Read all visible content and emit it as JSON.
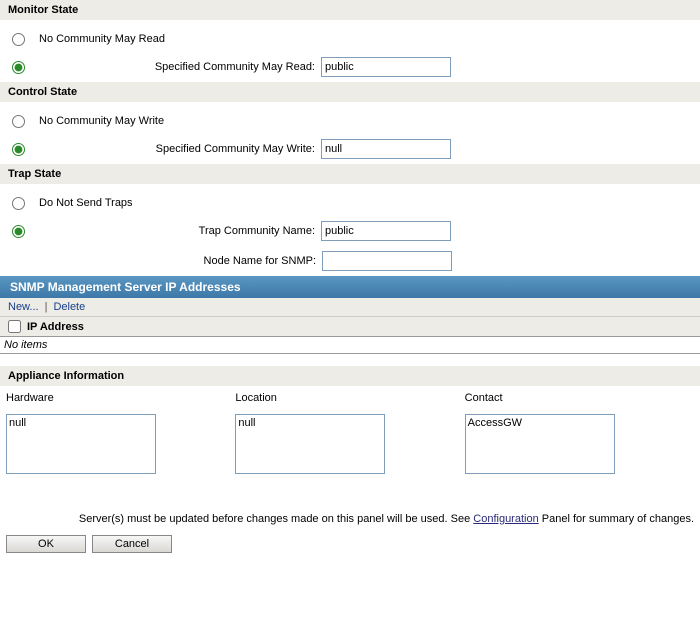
{
  "sections": {
    "monitor": {
      "title": "Monitor State",
      "opt_none": "No Community May Read",
      "opt_spec_label": "Specified Community May Read:",
      "value": "public"
    },
    "control": {
      "title": "Control State",
      "opt_none": "No Community May Write",
      "opt_spec_label": "Specified Community May Write:",
      "value": "null"
    },
    "trap": {
      "title": "Trap State",
      "opt_none": "Do Not Send Traps",
      "community_label": "Trap Community Name:",
      "community_value": "public",
      "node_label": "Node Name for SNMP:",
      "node_value": ""
    }
  },
  "snmp_servers": {
    "title": "SNMP Management Server IP Addresses",
    "new_label": "New...",
    "delete_label": "Delete",
    "column": "IP Address",
    "empty": "No items"
  },
  "appliance": {
    "title": "Appliance Information",
    "hardware_label": "Hardware",
    "location_label": "Location",
    "contact_label": "Contact",
    "hardware": "null",
    "location": "null",
    "contact": "AccessGW"
  },
  "notice": {
    "pre": "Server(s) must be updated before changes made on this panel will be used. See ",
    "link": "Configuration",
    "post": " Panel for summary of changes."
  },
  "buttons": {
    "ok": "OK",
    "cancel": "Cancel"
  }
}
